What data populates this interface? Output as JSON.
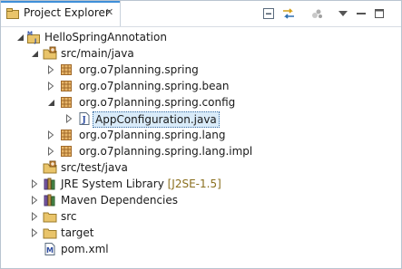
{
  "view": {
    "tab_title": "Project Explorer",
    "tab_close": "✕",
    "toolbar": [
      "collapse-all-icon",
      "link-with-editor-icon",
      "focus-icon",
      "view-menu-icon",
      "minimize-icon",
      "maximize-icon"
    ]
  },
  "tree": {
    "project": "HelloSpringAnnotation",
    "src_main": "src/main/java",
    "pkg_spring": "org.o7planning.spring",
    "pkg_bean": "org.o7planning.spring.bean",
    "pkg_config": "org.o7planning.spring.config",
    "file_appconfig": "AppConfiguration.java",
    "pkg_lang": "org.o7planning.spring.lang",
    "pkg_lang_impl": "org.o7planning.spring.lang.impl",
    "src_test": "src/test/java",
    "jre_label": "JRE System Library",
    "jre_version": "[J2SE-1.5]",
    "maven": "Maven Dependencies",
    "src": "src",
    "target": "target",
    "pom": "pom.xml"
  }
}
